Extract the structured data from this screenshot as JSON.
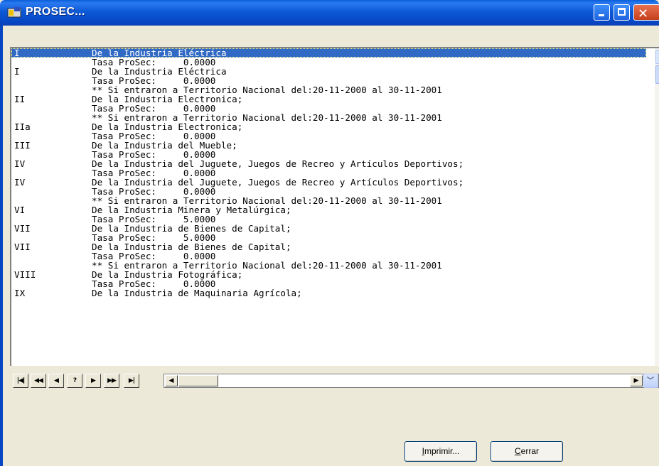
{
  "window": {
    "title": "PROSEC...",
    "icon": "app-icon",
    "accent": "#0a5fd8",
    "selection_color": "#316ac5"
  },
  "list": {
    "rows": [
      {
        "code": "I",
        "desc": "De la Industria Eléctrica",
        "selected": true
      },
      {
        "code": "",
        "desc": "Tasa ProSec:     0.0000"
      },
      {
        "code": "I",
        "desc": "De la Industria Eléctrica"
      },
      {
        "code": "",
        "desc": "Tasa ProSec:     0.0000"
      },
      {
        "code": "",
        "desc": "** Si entraron a Territorio Nacional del:20-11-2000 al 30-11-2001"
      },
      {
        "code": "II",
        "desc": "De la Industria Electronica;"
      },
      {
        "code": "",
        "desc": "Tasa ProSec:     0.0000"
      },
      {
        "code": "",
        "desc": "** Si entraron a Territorio Nacional del:20-11-2000 al 30-11-2001"
      },
      {
        "code": "IIa",
        "desc": "De la Industria Electronica;"
      },
      {
        "code": "",
        "desc": "Tasa ProSec:     0.0000"
      },
      {
        "code": "III",
        "desc": "De la Industria del Mueble;"
      },
      {
        "code": "",
        "desc": "Tasa ProSec:     0.0000"
      },
      {
        "code": "IV",
        "desc": "De la Industria del Juguete, Juegos de Recreo y Artículos Deportivos;"
      },
      {
        "code": "",
        "desc": "Tasa ProSec:     0.0000"
      },
      {
        "code": "IV",
        "desc": "De la Industria del Juguete, Juegos de Recreo y Artículos Deportivos;"
      },
      {
        "code": "",
        "desc": "Tasa ProSec:     0.0000"
      },
      {
        "code": "",
        "desc": "** Si entraron a Territorio Nacional del:20-11-2000 al 30-11-2001"
      },
      {
        "code": "VI",
        "desc": "De la Industria Minera y Metalúrgica;"
      },
      {
        "code": "",
        "desc": "Tasa ProSec:     5.0000"
      },
      {
        "code": "VII",
        "desc": "De la Industria de Bienes de Capital;"
      },
      {
        "code": "",
        "desc": "Tasa ProSec:     5.0000"
      },
      {
        "code": "VII",
        "desc": "De la Industria de Bienes de Capital;"
      },
      {
        "code": "",
        "desc": "Tasa ProSec:     0.0000"
      },
      {
        "code": "",
        "desc": "** Si entraron a Territorio Nacional del:20-11-2000 al 30-11-2001"
      },
      {
        "code": "VIII",
        "desc": "De la Industria Fotográfica;"
      },
      {
        "code": "",
        "desc": "Tasa ProSec:     0.0000"
      },
      {
        "code": "IX",
        "desc": "De la Industria de Maquinaria Agrícola;"
      }
    ]
  },
  "navigator": {
    "buttons": [
      {
        "name": "first-record-button",
        "glyph": "|◀|"
      },
      {
        "name": "prev-page-button",
        "glyph": "◀◀"
      },
      {
        "name": "prev-record-button",
        "glyph": "◀"
      },
      {
        "name": "help-button",
        "glyph": "?"
      },
      {
        "name": "next-record-button",
        "glyph": "▶"
      },
      {
        "name": "next-page-button",
        "glyph": "▶▶"
      },
      {
        "name": "last-record-button",
        "glyph": "▶|"
      }
    ]
  },
  "buttons": {
    "print_prefix": "I",
    "print_rest": "mprimir...",
    "close_prefix": "C",
    "close_rest": "errar"
  }
}
